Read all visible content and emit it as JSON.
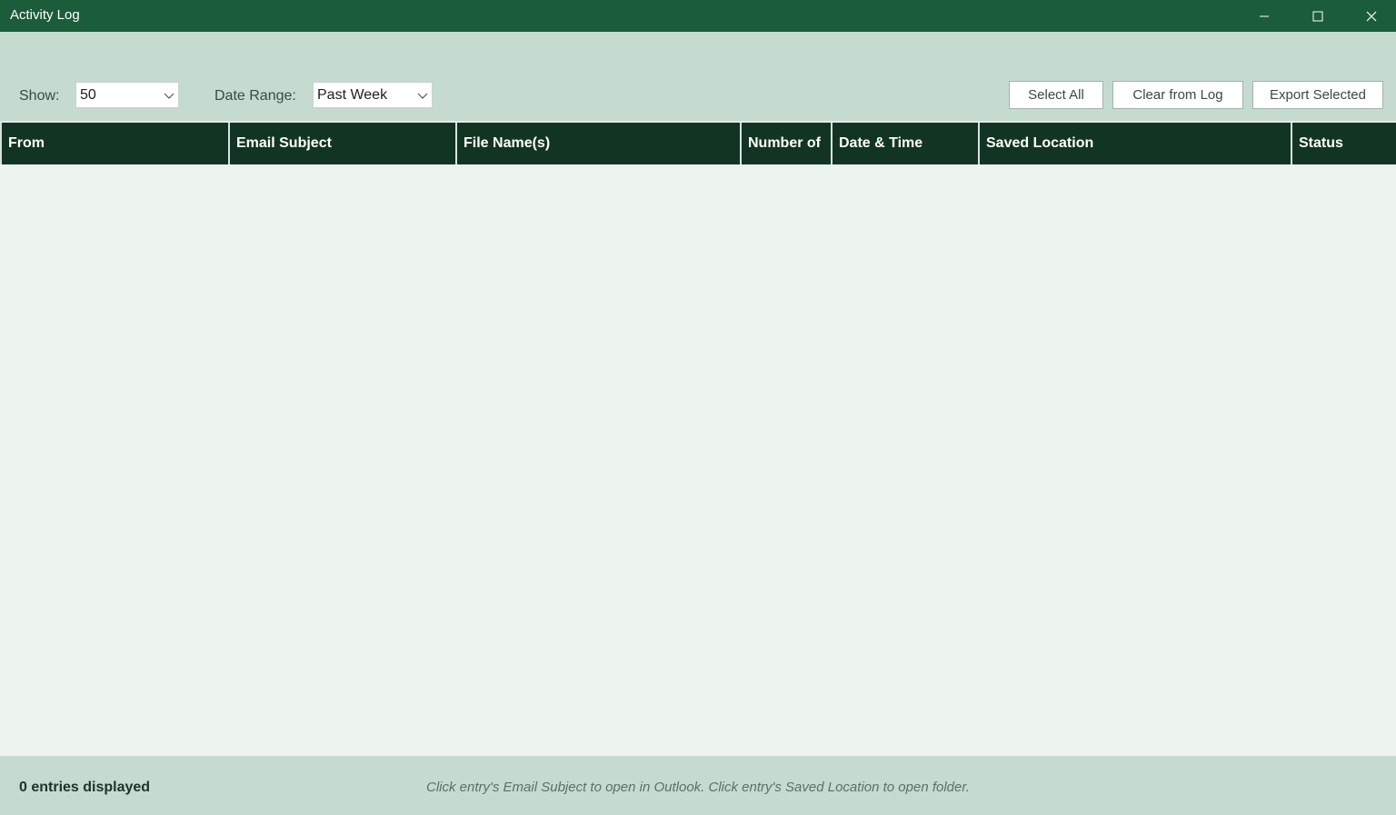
{
  "window": {
    "title": "Activity Log"
  },
  "toolbar": {
    "show_label": "Show:",
    "show_value": "50",
    "date_range_label": "Date Range:",
    "date_range_value": "Past Week",
    "select_all": "Select All",
    "clear_from_log": "Clear from Log",
    "export_selected": "Export Selected"
  },
  "table": {
    "columns": [
      {
        "label": "From"
      },
      {
        "label": "Email Subject"
      },
      {
        "label": "File Name(s)"
      },
      {
        "label": "Number of"
      },
      {
        "label": "Date & Time"
      },
      {
        "label": "Saved Location"
      },
      {
        "label": "Status"
      }
    ],
    "rows": []
  },
  "status": {
    "count_text": "0 entries displayed",
    "hint": "Click entry's Email Subject to open in Outlook. Click entry's Saved Location to open folder."
  },
  "colors": {
    "titlebar": "#1b5c3a",
    "header": "#123523",
    "panel": "#c5dbd0",
    "body": "#edf3ef"
  }
}
